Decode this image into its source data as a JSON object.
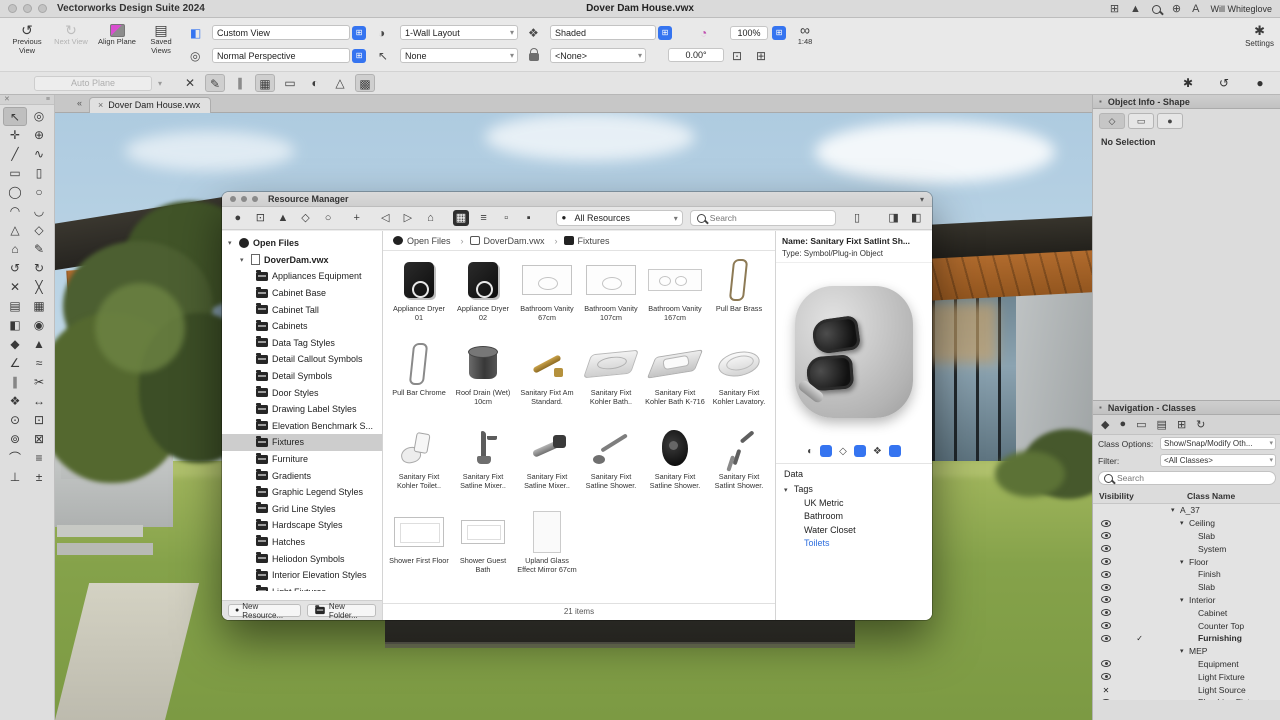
{
  "menubar": {
    "app_name": "Vectorworks Design Suite 2024",
    "document_title": "Dover Dam House.vwx",
    "user_name": "Will Whiteglove",
    "icons": {
      "apps": "⊞",
      "upload": "▲",
      "search": "magnifier",
      "share": "⊕",
      "text_size": "A"
    }
  },
  "toolbar": {
    "previous_view": "Previous View",
    "next_view": "Next View",
    "align_plane": "Align Plane",
    "saved_views": "Saved Views",
    "view_value": "Custom View",
    "projection_value": "Normal Perspective",
    "layout_value": "1-Wall Layout",
    "plane_value": "None",
    "render_value": "Shaded",
    "class_value": "<None>",
    "rotation_value": "0.00°",
    "zoom_value": "100%",
    "scale_value": "1:48",
    "scale_icon": "∞",
    "settings_label": "Settings",
    "settings_icon": "✱",
    "auto_plane": "Auto Plane",
    "icon_previous": "↺",
    "icon_next": "↻",
    "icon_saved_views": "▤",
    "icon_view_menu": "◧",
    "icon_projection": "◎",
    "icon_render": "❖",
    "icon_layout": "◑",
    "icon_plane": "↖",
    "icon_rotate": "◔"
  },
  "mode_bar": {
    "icons": [
      "✕",
      "✎",
      "∥",
      "▦",
      "▭",
      "◐",
      "△",
      "▩"
    ],
    "right_icons": [
      "✱",
      "↺",
      "●"
    ]
  },
  "tool_palette": [
    "↖",
    "◎",
    "✛",
    "⊕",
    "╱",
    "∿",
    "▭",
    "▯",
    "◯",
    "○",
    "◠",
    "◡",
    "△",
    "◇",
    "⌂",
    "✎",
    "↺",
    "↻",
    "✕",
    "╳",
    "▤",
    "▦",
    "◧",
    "◉",
    "◆",
    "▲",
    "∠",
    "≈",
    "∥",
    "✂",
    "❖",
    "↔",
    "⊙",
    "⊡",
    "⊚",
    "⊠",
    "⌒",
    "≡",
    "⊥",
    "±"
  ],
  "doc_tab": {
    "collapse": "«",
    "close": "×",
    "label": "Dover Dam House.vwx"
  },
  "object_info": {
    "title": "Object Info - Shape",
    "tabs": [
      "◇",
      "▭",
      "●"
    ],
    "no_selection": "No Selection"
  },
  "navigation": {
    "title": "Navigation - Classes",
    "toolbar_icons": [
      "◆",
      "●",
      "▭",
      "▤",
      "⊞",
      "↻"
    ],
    "class_options_label": "Class Options:",
    "class_options_value": "Show/Snap/Modify Oth...",
    "filter_label": "Filter:",
    "filter_value": "<All Classes>",
    "search_placeholder": "Search",
    "visibility_header": "Visibility",
    "class_name_header": "Class Name",
    "rows": [
      {
        "label": "A_37",
        "indent": 0,
        "disc": true,
        "vis": "none"
      },
      {
        "label": "Ceiling",
        "indent": 1,
        "disc": true,
        "vis": "eye"
      },
      {
        "label": "Slab",
        "indent": 2,
        "vis": "eye"
      },
      {
        "label": "System",
        "indent": 2,
        "vis": "eye"
      },
      {
        "label": "Floor",
        "indent": 1,
        "disc": true,
        "vis": "eye"
      },
      {
        "label": "Finish",
        "indent": 2,
        "vis": "eye"
      },
      {
        "label": "Slab",
        "indent": 2,
        "vis": "eye"
      },
      {
        "label": "Interior",
        "indent": 1,
        "disc": true,
        "vis": "eye"
      },
      {
        "label": "Cabinet",
        "indent": 2,
        "vis": "eye"
      },
      {
        "label": "Counter Top",
        "indent": 2,
        "vis": "eye"
      },
      {
        "label": "Furnishing",
        "indent": 2,
        "vis": "eye",
        "active": true,
        "bold": true
      },
      {
        "label": "MEP",
        "indent": 1,
        "disc": true,
        "vis": "none"
      },
      {
        "label": "Equipment",
        "indent": 2,
        "vis": "eye"
      },
      {
        "label": "Light Fixture",
        "indent": 2,
        "vis": "eye"
      },
      {
        "label": "Light Source",
        "indent": 2,
        "vis": "x"
      },
      {
        "label": "Plumbing Fixture",
        "indent": 2,
        "vis": "eye"
      }
    ]
  },
  "resource_manager": {
    "window_title": "Resource Manager",
    "window_caret": "▾",
    "toolbar_icons": [
      "●",
      "⊡",
      "▲",
      "◇",
      "○",
      "+",
      "◁",
      "▷",
      "⌂",
      "▦",
      "≡",
      "▫",
      "▪"
    ],
    "filter_value": "All Resources",
    "search_placeholder": "Search",
    "right_buttons": [
      "▯",
      "◨",
      "◧"
    ],
    "breadcrumb": [
      {
        "label": "Open Files",
        "icon": "files-root"
      },
      {
        "label": "DoverDam.vwx",
        "icon": "vwx-file"
      },
      {
        "label": "Fixtures",
        "icon": "folder-bc"
      }
    ],
    "tree_root": "Open Files",
    "tree_file": "DoverDam.vwx",
    "folders": [
      {
        "label": "Appliances Equipment"
      },
      {
        "label": "Cabinet Base"
      },
      {
        "label": "Cabinet Tall"
      },
      {
        "label": "Cabinets"
      },
      {
        "label": "Data Tag Styles"
      },
      {
        "label": "Detail Callout Symbols"
      },
      {
        "label": "Detail Symbols"
      },
      {
        "label": "Door Styles"
      },
      {
        "label": "Drawing Label Styles"
      },
      {
        "label": "Elevation Benchmark S..."
      },
      {
        "label": "Fixtures",
        "selected": true
      },
      {
        "label": "Furniture"
      },
      {
        "label": "Gradients"
      },
      {
        "label": "Graphic Legend Styles"
      },
      {
        "label": "Grid Line Styles"
      },
      {
        "label": "Hardscape Styles"
      },
      {
        "label": "Hatches"
      },
      {
        "label": "Heliodon Symbols"
      },
      {
        "label": "Interior Elevation Styles"
      },
      {
        "label": "Light Fixtures"
      }
    ],
    "items": [
      {
        "label": "Appliance Dryer 01",
        "icon": "dryer"
      },
      {
        "label": "Appliance Dryer 02",
        "icon": "dryer"
      },
      {
        "label": "Bathroom Vanity 67cm",
        "icon": "vanity"
      },
      {
        "label": "Bathroom Vanity 107cm",
        "icon": "vanity"
      },
      {
        "label": "Bathroom Vanity 167cm",
        "icon": "vanity-double"
      },
      {
        "label": "Pull Bar Brass",
        "icon": "pull-bar-brass"
      },
      {
        "label": "Pull Bar Chrome",
        "icon": "pull-bar"
      },
      {
        "label": "Roof Drain (Wet) 10cm",
        "icon": "drain"
      },
      {
        "label": "Sanitary Fixt Am Standard.",
        "icon": "faucet-brass"
      },
      {
        "label": "Sanitary Fixt Kohler Bath..",
        "icon": "bathtub"
      },
      {
        "label": "Sanitary Fixt Kohler Bath K-716",
        "icon": "bathtub-iso"
      },
      {
        "label": "Sanitary Fixt Kohler Lavatory.",
        "icon": "sink-oval"
      },
      {
        "label": "Sanitary Fixt Kohler Toilet..",
        "icon": "toilet"
      },
      {
        "label": "Sanitary Fixt Satline Mixer..",
        "icon": "mixer-tall"
      },
      {
        "label": "Sanitary Fixt Satline Mixer..",
        "icon": "wall-mixer"
      },
      {
        "label": "Sanitary Fixt Satline Shower.",
        "icon": "shower-wand"
      },
      {
        "label": "Sanitary Fixt Satline Shower.",
        "icon": "shower-panel"
      },
      {
        "label": "Sanitary Fixt Satlint Shower.",
        "icon": "hand-shower"
      },
      {
        "label": "Shower First Floor",
        "icon": "shower-pan"
      },
      {
        "label": "Shower Guest Bath",
        "icon": "shower-pan-small"
      },
      {
        "label": "Upland Glass Effect Mirror 67cm",
        "icon": "mirror"
      }
    ],
    "items_count": "21 items",
    "new_resource": "New Resource...",
    "new_folder": "New Folder...",
    "detail": {
      "name_line": "Name: Sanitary Fixt Satlint Sh...",
      "type_line": "Type: Symbol/Plug-in Object",
      "action_icons": [
        "◐",
        "◇",
        "❖"
      ],
      "data_section": "Data",
      "tags_section": "Tags",
      "tags": [
        {
          "label": "UK Metric"
        },
        {
          "label": "Bathroom"
        },
        {
          "label": "Water Closet"
        },
        {
          "label": "Toilets",
          "link": true
        }
      ]
    }
  },
  "colors": {
    "accent_blue": "#3574f0",
    "tag_link_blue": "#2f6fde",
    "grass_green": "#85a24a",
    "sky_blue": "#aecbe0",
    "wood_brown": "#b26c2e"
  }
}
